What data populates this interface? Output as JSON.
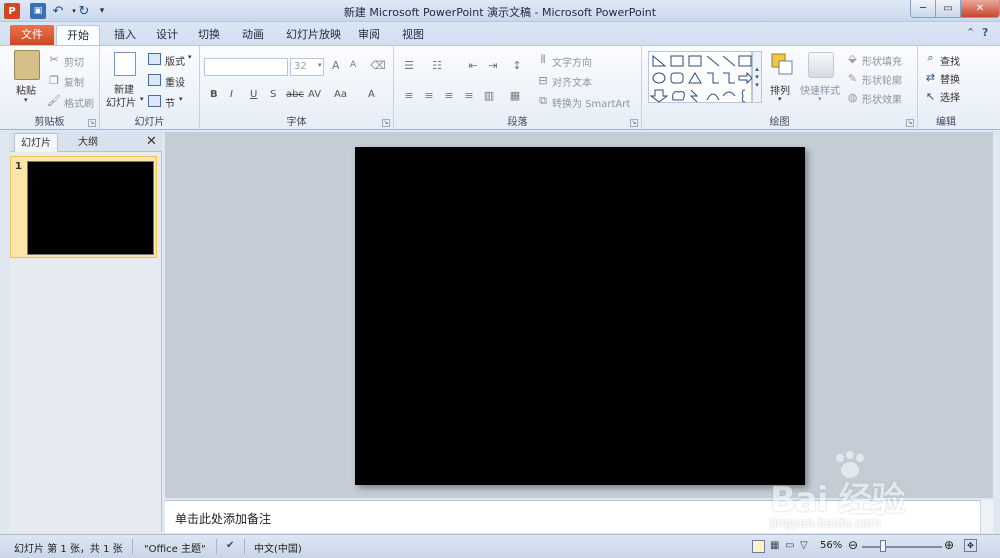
{
  "window": {
    "title": "新建 Microsoft PowerPoint 演示文稿 - Microsoft PowerPoint",
    "app_icon": "powerpoint-icon",
    "quick_access": [
      "save-icon",
      "undo-icon",
      "redo-icon",
      "customize-icon"
    ]
  },
  "tabs": [
    "文件",
    "开始",
    "插入",
    "设计",
    "切换",
    "动画",
    "幻灯片放映",
    "审阅",
    "视图"
  ],
  "active_tab": "开始",
  "ribbon": {
    "clipboard": {
      "label": "剪贴板",
      "paste": "粘贴",
      "cut": "剪切",
      "copy": "复制",
      "format_painter": "格式刷"
    },
    "slides": {
      "label": "幻灯片",
      "new_slide_1": "新建",
      "new_slide_2": "幻灯片",
      "layout": "版式",
      "reset": "重设",
      "section": "节"
    },
    "font": {
      "label": "字体",
      "font_name": "",
      "font_size": "32",
      "bold": "B",
      "italic": "I",
      "underline": "U",
      "shadow": "S",
      "strike": "abc",
      "spacing": "AV",
      "case": "Aa",
      "grow": "A",
      "shrink": "A"
    },
    "paragraph": {
      "label": "段落",
      "text_direction": "文字方向",
      "align_text": "对齐文本",
      "smartart": "转换为 SmartArt"
    },
    "drawing": {
      "label": "绘图",
      "arrange": "排列",
      "quick_styles": "快速样式",
      "shape_fill": "形状填充",
      "shape_outline": "形状轮廓",
      "shape_effects": "形状效果"
    },
    "editing": {
      "label": "编辑",
      "find": "查找",
      "replace": "替换",
      "select": "选择"
    }
  },
  "left_panel": {
    "tabs": [
      "幻灯片",
      "大纲"
    ],
    "thumbnails": [
      {
        "number": "1"
      }
    ]
  },
  "notes": {
    "placeholder": "单击此处添加备注"
  },
  "status_bar": {
    "slide_info": "幻灯片 第 1 张，共 1 张",
    "theme": "\"Office 主题\"",
    "language": "中文(中国)",
    "zoom": "56%"
  },
  "watermark": {
    "brand": "Bai 经验",
    "sub": "jingyan.baidu.com"
  },
  "colors": {
    "file_tab": "#d24726",
    "ribbon_bg": "#f3f6fa",
    "slide": "#000000",
    "thumb_highlight": "#fbe6a8"
  }
}
